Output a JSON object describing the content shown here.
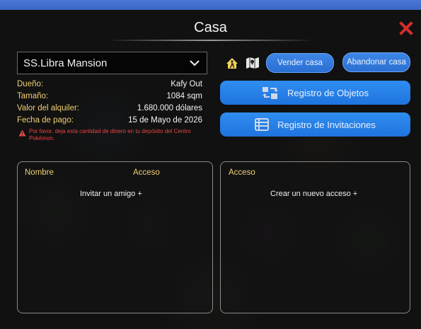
{
  "window": {
    "title": "Casa"
  },
  "house_select": {
    "value": "SS.Libra Mansion"
  },
  "actions": {
    "sell_label": "Vender casa",
    "abandon_label": "Abandonar casa",
    "object_log_label": "Registro de Objetos",
    "invite_log_label": "Registro de Invitaciones"
  },
  "icons": {
    "walk": "person-walking-icon",
    "map": "map-icon",
    "objects": "transfer-boxes-icon",
    "list": "list-icon",
    "warning": "warning-triangle-icon",
    "close": "close-icon",
    "chevron": "chevron-down-icon"
  },
  "details": {
    "owner_label": "Dueño:",
    "owner_value": "Kafy Out",
    "size_label": "Tamaño:",
    "size_value": "1084 sqm",
    "rent_label": "Valor del alquiler:",
    "rent_value": "1.680.000 dólares",
    "due_label": "Fecha de pago:",
    "due_value": "15 de Mayo de 2026"
  },
  "warning_text": "Por favor, deja esta cantidad de dinero en tu depósito del Centro Pokémon.",
  "members_panel": {
    "col_name": "Nombre",
    "col_access": "Acceso",
    "invite_link": "Invitar un amigo +"
  },
  "access_panel": {
    "col_access": "Acceso",
    "create_link": "Crear un nuevo acceso +"
  },
  "colors": {
    "accent_blue": "#2f8df0",
    "label_gold": "#f0d070",
    "warning_red": "#e84545",
    "close_red": "#d42d2d"
  }
}
